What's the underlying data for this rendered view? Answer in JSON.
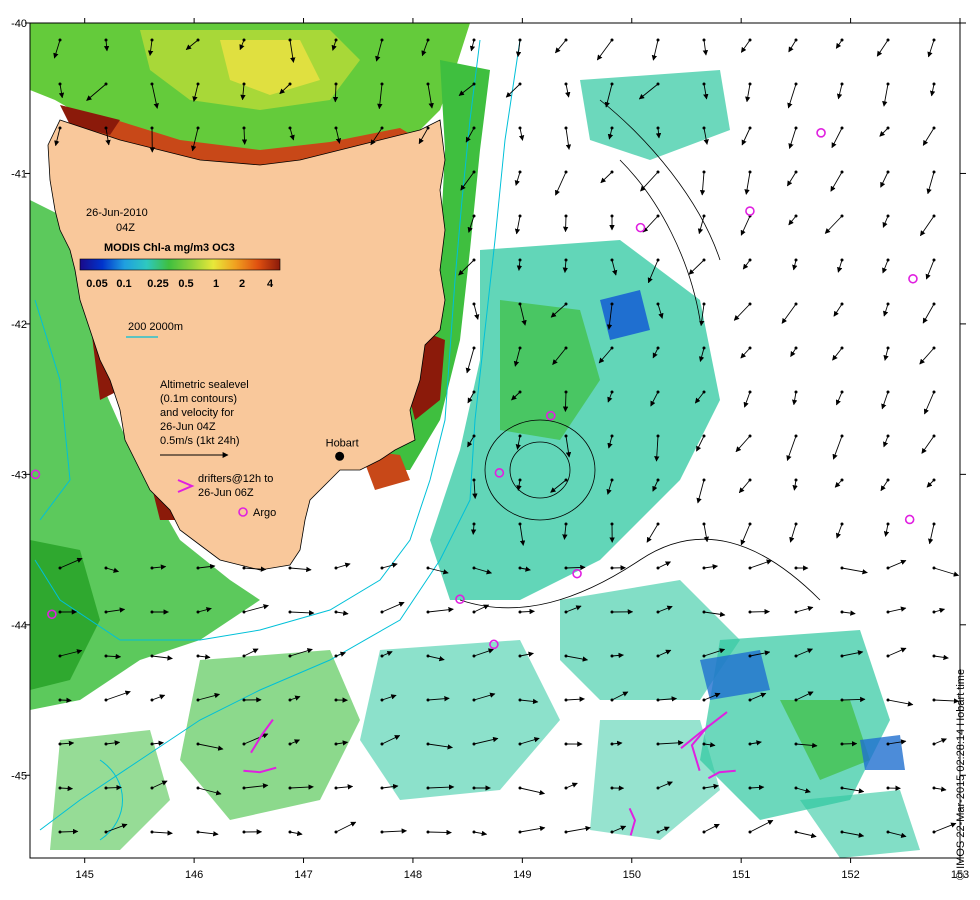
{
  "map": {
    "date": "26-Jun-2010",
    "time": "04Z",
    "colorbar_title": "MODIS Chl-a mg/m3 OC3",
    "colorbar_ticks": [
      "0.05",
      "0.1",
      "0.25",
      "0.5",
      "1",
      "2",
      "4"
    ],
    "colorbar_colors": [
      "#1a0a8a",
      "#0033cc",
      "#1f9fe0",
      "#2ec8c0",
      "#3fbf3f",
      "#8fd13a",
      "#e8e83a",
      "#f0a020",
      "#e05010",
      "#8b1a0a"
    ],
    "isobath_label": "200  2000m",
    "legend_lines": [
      "Altimetric sealevel",
      "(0.1m contours)",
      "and velocity for",
      "26-Jun 04Z",
      "0.5m/s (1kt 24h)"
    ],
    "drifter_label_1": "drifters@12h to",
    "drifter_label_2": "26-Jun 06Z",
    "argo_label": "Argo",
    "city_label": "Hobart",
    "credit": "© IMOS 22-Mar-2015 02:28:14 Hobart time",
    "colors": {
      "land": "#f9c89b",
      "isobath": "#00c0d8",
      "drifter": "#e020e0",
      "argo": "#e020e0"
    }
  },
  "chart_data": {
    "type": "map",
    "xlabel": "",
    "ylabel": "",
    "xlim": [
      144.5,
      153
    ],
    "ylim": [
      -45.55,
      -40
    ],
    "x_ticks": [
      "145",
      "146",
      "147",
      "148",
      "149",
      "150",
      "151",
      "152",
      "153"
    ],
    "y_ticks": [
      "-40",
      "-41",
      "-42",
      "-43",
      "-44",
      "-45"
    ],
    "hobart": {
      "lon": 147.33,
      "lat": -42.88
    },
    "argo_floats": [
      {
        "lon": 151.73,
        "lat": -40.73
      },
      {
        "lon": 151.08,
        "lat": -41.25
      },
      {
        "lon": 150.08,
        "lat": -41.36
      },
      {
        "lon": 152.57,
        "lat": -41.7
      },
      {
        "lon": 149.26,
        "lat": -42.61
      },
      {
        "lon": 148.79,
        "lat": -42.99
      },
      {
        "lon": 144.55,
        "lat": -43.0
      },
      {
        "lon": 152.54,
        "lat": -43.3
      },
      {
        "lon": 149.5,
        "lat": -43.66
      },
      {
        "lon": 148.43,
        "lat": -43.83
      },
      {
        "lon": 148.74,
        "lat": -44.13
      },
      {
        "lon": 144.7,
        "lat": -43.93
      }
    ],
    "drifters": [
      [
        [
          146.45,
          -44.97
        ],
        [
          146.6,
          -44.98
        ],
        [
          146.75,
          -44.95
        ]
      ],
      [
        [
          146.72,
          -44.63
        ],
        [
          146.62,
          -44.73
        ],
        [
          146.52,
          -44.85
        ]
      ],
      [
        [
          150.87,
          -44.58
        ],
        [
          150.62,
          -44.72
        ],
        [
          150.45,
          -44.82
        ]
      ],
      [
        [
          150.7,
          -44.67
        ],
        [
          150.55,
          -44.8
        ],
        [
          150.62,
          -44.97
        ]
      ],
      [
        [
          150.95,
          -44.97
        ],
        [
          150.8,
          -44.98
        ],
        [
          150.7,
          -45.02
        ]
      ],
      [
        [
          149.99,
          -45.4
        ],
        [
          150.03,
          -45.3
        ],
        [
          149.98,
          -45.22
        ]
      ]
    ]
  }
}
